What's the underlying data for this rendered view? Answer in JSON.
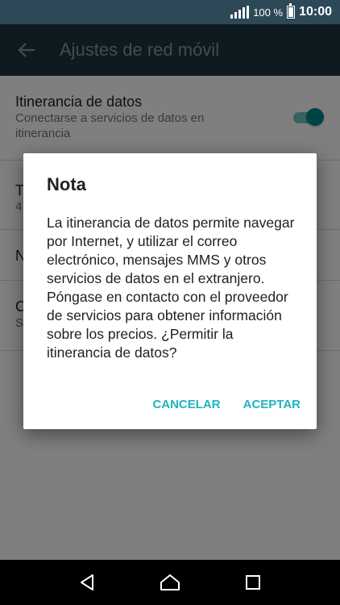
{
  "status_bar": {
    "battery_percent": "100 %",
    "time": "10:00"
  },
  "app_bar": {
    "title": "Ajustes de red móvil"
  },
  "settings": [
    {
      "title": "Itinerancia de datos",
      "subtitle": "Conectarse a servicios de datos en itinerancia",
      "toggle_on": true
    },
    {
      "title": "T",
      "subtitle": "4"
    },
    {
      "title": "N",
      "subtitle": ""
    },
    {
      "title": "C",
      "subtitle": "S"
    }
  ],
  "dialog": {
    "title": "Nota",
    "body": "La itinerancia de datos permite navegar por Internet, y utilizar el correo electrónico, mensajes MMS y otros servicios de datos en el extranjero. Póngase en contacto con el proveedor de servicios para obtener información sobre los precios. ¿Permitir la itinerancia de datos?",
    "cancel_label": "CANCELAR",
    "accept_label": "ACEPTAR"
  },
  "colors": {
    "accent": "#1fb4bd",
    "status_bar": "#2d4857",
    "app_bar": "#1e3240"
  }
}
